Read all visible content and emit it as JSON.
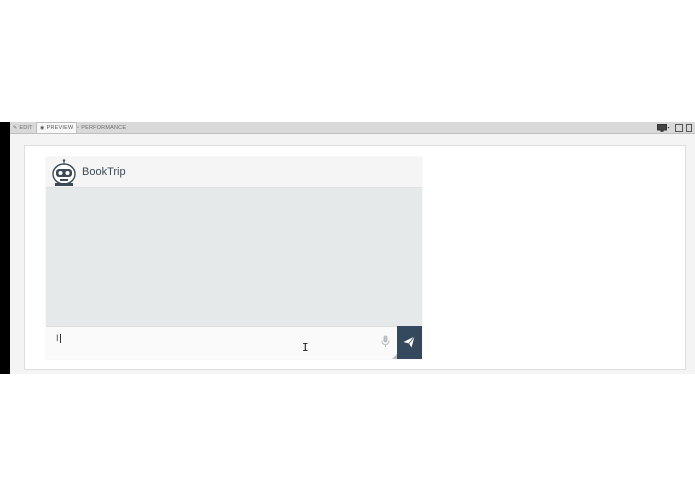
{
  "tabs": [
    {
      "label": "EDIT",
      "icon": "pencil-icon"
    },
    {
      "label": "PREVIEW",
      "icon": "eye-icon"
    },
    {
      "label": "PERFORMANCE",
      "icon": "gauge-icon"
    }
  ],
  "active_tab": "PREVIEW",
  "device_icons": [
    "desktop-icon",
    "tablet-icon",
    "mobile-icon"
  ],
  "widget": {
    "title": "BookTrip",
    "avatar_icon": "robot-icon",
    "input_value": "I",
    "mic_icon": "microphone-icon",
    "send_icon": "paper-plane-icon"
  },
  "colors": {
    "send_button": "#34495e",
    "chat_background": "#e6e9e9",
    "header_background": "#f5f5f5",
    "title_text": "#3d4a55"
  }
}
